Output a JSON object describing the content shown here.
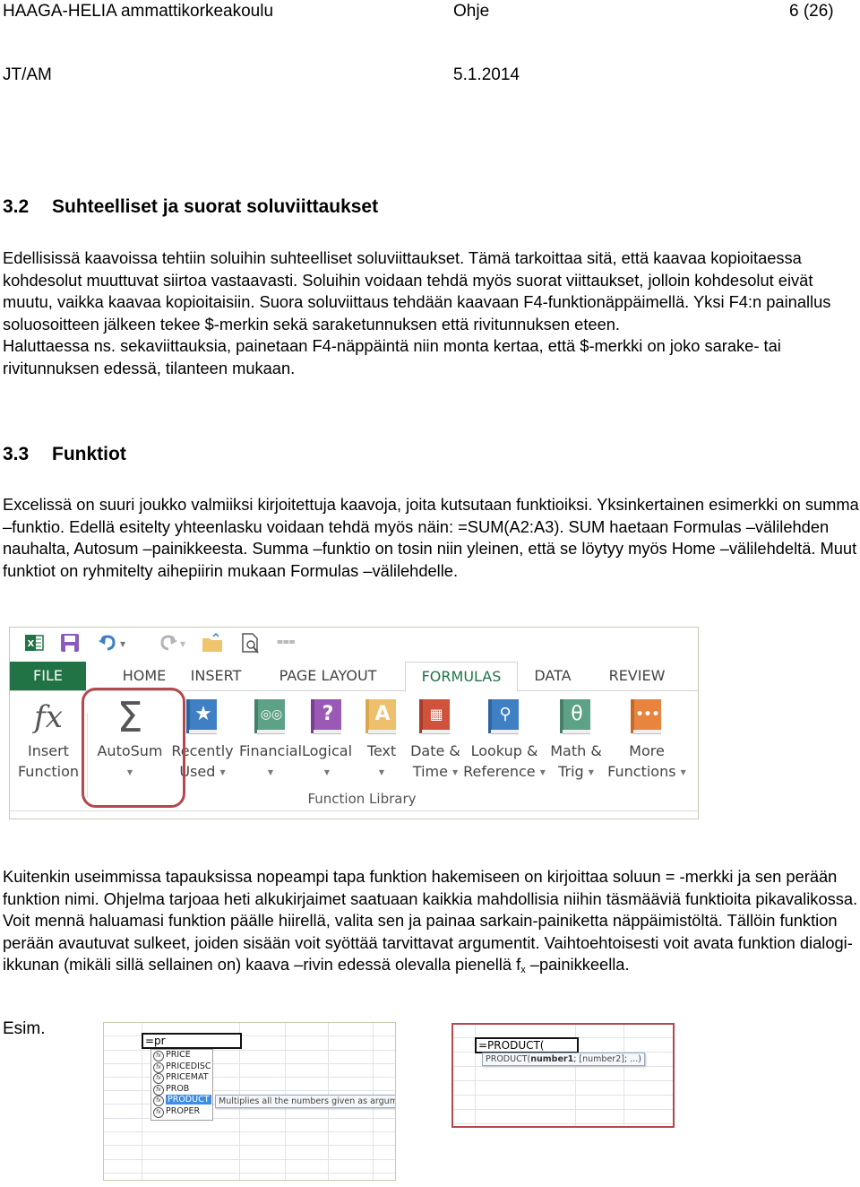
{
  "header": {
    "organization": "HAAGA-HELIA ammattikorkeakoulu",
    "doc_type": "Ohje",
    "page": "6 (26)",
    "author": "JT/AM",
    "date": "5.1.2014"
  },
  "section_32": {
    "number": "3.2",
    "title": "Suhteelliset ja suorat soluviittaukset",
    "paragraph1": "Edellisissä kaavoissa tehtiin soluihin suhteelliset soluviittaukset. Tämä tarkoittaa sitä, että kaavaa kopioitaessa kohdesolut muuttuvat siirtoa vastaavasti. Soluihin voidaan tehdä myös suorat viittaukset, jolloin kohdesolut eivät muutu, vaikka kaavaa kopioitaisiin. Suora soluviittaus tehdään kaavaan F4-funktionäppäimellä. Yksi F4:n painallus soluosoitteen jälkeen tekee $-merkin sekä saraketunnuksen että rivitunnuksen eteen.",
    "paragraph2": "Haluttaessa ns. sekaviittauksia, painetaan F4-näppäintä niin monta kertaa, että $-merkki on joko sarake- tai rivitunnuksen edessä, tilanteen mukaan."
  },
  "section_33": {
    "number": "3.3",
    "title": "Funktiot",
    "paragraph1": "Excelissä on suuri joukko valmiiksi kirjoitettuja kaavoja, joita kutsutaan funktioiksi. Yksinkertainen esimerkki on summa –funktio. Edellä esitelty yhteenlasku voidaan tehdä myös näin: =SUM(A2:A3). SUM haetaan Formulas –välilehden nauhalta, Autosum –painikkeesta. Summa –funktio on tosin niin yleinen, että se löytyy myös Home –välilehdeltä. Muut funktiot on ryhmitelty aihepiirin mukaan Formulas –välilehdelle.",
    "paragraph2_before_fx": "Kuitenkin useimmissa tapauksissa nopeampi tapa funktion hakemiseen on kirjoittaa soluun = -merkki ja sen perään funktion nimi. Ohjelma tarjoaa heti alkukirjaimet saatuaan kaikkia mahdollisia niihin täsmääviä funktioita pikavalikossa. Voit mennä haluamasi funktion päälle hiirellä, valita sen ja painaa sarkain-painiketta näppäimistöltä. Tällöin funktion perään avautuvat sulkeet, joiden sisään voit syöttää tarvittavat argumentit. Vaihtoehtoisesti voit avata funktion dialogi-ikkunan (mikäli sillä sellainen on) kaava –rivin edessä olevalla pienellä f",
    "fx_sub": "x",
    "paragraph2_after_fx": " –painikkeella.",
    "example_label": "Esim."
  },
  "ribbon": {
    "qat_icons": [
      "excel-logo-icon",
      "save-icon",
      "undo-icon",
      "redo-icon",
      "open-folder-icon",
      "print-preview-icon",
      "customize-qat-icon"
    ],
    "tabs": [
      {
        "label": "FILE"
      },
      {
        "label": "HOME"
      },
      {
        "label": "INSERT"
      },
      {
        "label": "PAGE LAYOUT"
      },
      {
        "label": "FORMULAS",
        "active": true
      },
      {
        "label": "DATA"
      },
      {
        "label": "REVIEW"
      }
    ],
    "buttons": [
      {
        "line1": "Insert",
        "line2": "Function",
        "icon": "fx",
        "dropdown": false
      },
      {
        "line1": "AutoSum",
        "line2": "",
        "icon": "Σ",
        "dropdown": true,
        "highlighted": true
      },
      {
        "line1": "Recently",
        "line2": "Used",
        "icon": "★",
        "color": "#3f7fc4",
        "dropdown": true
      },
      {
        "line1": "Financial",
        "line2": "",
        "icon": "coins",
        "color": "#5da287",
        "dropdown": true
      },
      {
        "line1": "Logical",
        "line2": "",
        "icon": "?",
        "color": "#9b59b6",
        "dropdown": true
      },
      {
        "line1": "Text",
        "line2": "",
        "icon": "A",
        "color": "#eec06b",
        "dropdown": true
      },
      {
        "line1": "Date &",
        "line2": "Time",
        "icon": "calendar",
        "color": "#d0523b",
        "dropdown": true
      },
      {
        "line1": "Lookup &",
        "line2": "Reference",
        "icon": "magnifier",
        "color": "#3f7fc4",
        "dropdown": true
      },
      {
        "line1": "Math &",
        "line2": "Trig",
        "icon": "θ",
        "color": "#5da287",
        "dropdown": true
      },
      {
        "line1": "More",
        "line2": "Functions",
        "icon": "...",
        "color": "#e8843e",
        "dropdown": true
      }
    ],
    "group_label": "Function Library",
    "accent_color": "#217346",
    "highlight_color": "#b5474d"
  },
  "example1": {
    "cell_input": "=pr",
    "suggestions": [
      "PRICE",
      "PRICEDISC",
      "PRICEMAT",
      "PROB",
      "PRODUCT",
      "PROPER"
    ],
    "selected_index": 4,
    "tooltip": "Multiplies all the numbers given as arguments"
  },
  "example2": {
    "cell_input": "=PRODUCT(",
    "tooltip_fn": "PRODUCT(",
    "tooltip_arg1": "number1",
    "tooltip_rest": "; [number2]; ...)"
  }
}
